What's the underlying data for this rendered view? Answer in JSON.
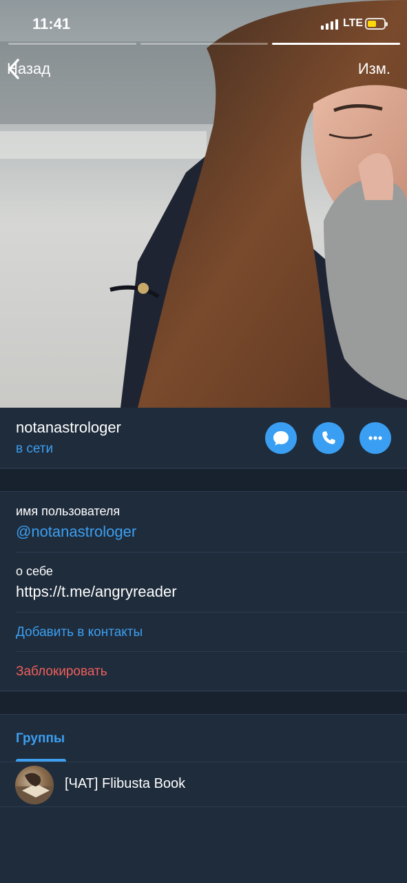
{
  "status_bar": {
    "time": "11:41",
    "network": "LTE",
    "battery_level": 0.45,
    "battery_color": "#ffd60a"
  },
  "story": {
    "segments": 3,
    "active_segment": 3
  },
  "nav": {
    "back_label": "Назад",
    "back_icon": "chevron-left-icon",
    "edit_label": "Изм."
  },
  "profile": {
    "name": "notanastrologer",
    "status": "в сети",
    "actions": [
      {
        "icon": "message-bubble-icon"
      },
      {
        "icon": "phone-icon"
      },
      {
        "icon": "more-dots-icon"
      }
    ]
  },
  "info": {
    "username_label": "имя пользователя",
    "username_value": "@notanastrologer",
    "bio_label": "о себе",
    "bio_value": "https://t.me/angryreader",
    "add_contact_label": "Добавить в контакты",
    "block_label": "Заблокировать"
  },
  "groups": {
    "tab_label": "Группы",
    "items": [
      {
        "name": "[ЧАТ] Flibusta Book"
      }
    ]
  },
  "colors": {
    "accent": "#3c9ff0",
    "danger": "#ef5f5a",
    "background": "#1f2c3c",
    "separator": "#18222f"
  }
}
